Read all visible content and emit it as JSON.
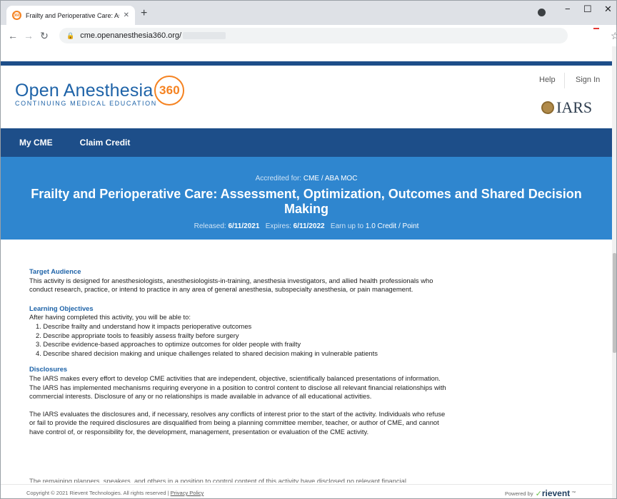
{
  "browser": {
    "tab_title": "Frailty and Perioperative Care: As",
    "tab_favicon": "360",
    "url": "cme.openanesthesia360.org/",
    "icons": [
      "back-icon",
      "forward-icon",
      "reload-icon",
      "lock-icon",
      "star-icon",
      "close-icon",
      "plus-icon"
    ]
  },
  "header": {
    "logo_text": "Open Anesthesia",
    "logo_badge": "360",
    "logo_subtitle": "CONTINUING MEDICAL EDUCATION",
    "help_label": "Help",
    "signin_label": "Sign In",
    "partner_logo": "IARS"
  },
  "nav": {
    "my_cme": "My CME",
    "claim_credit": "Claim Credit"
  },
  "hero": {
    "accredited_label": "Accredited for:",
    "accredited_value": "CME / ABA MOC",
    "title": "Frailty and Perioperative Care: Assessment, Optimization, Outcomes and Shared Decision Making",
    "released_label": "Released:",
    "released_value": "6/11/2021",
    "expires_label": "Expires:",
    "expires_value": "6/11/2022",
    "earn_label": "Earn up to",
    "earn_value": "1.0 Credit / Point",
    "bg_color": "#2f86cf"
  },
  "content": {
    "target_title": "Target Audience",
    "target_text": "This activity is designed for anesthesiologists, anesthesiologists-in-training, anesthesia investigators, and allied health professionals who conduct research, practice, or intend to practice in any area of general anesthesia, subspecialty anesthesia, or pain management.",
    "objectives_title": "Learning Objectives",
    "objectives_intro": "After having completed this activity, you will be able to:",
    "objectives": [
      "1. Describe frailty and understand how it impacts perioperative outcomes",
      "2. Describe appropriate tools to feasibly assess frailty before surgery",
      "3. Describe evidence-based approaches to optimize outcomes for older people with frailty",
      "4. Describe shared decision making and unique challenges related to shared decision making in vulnerable patients"
    ],
    "disclosures_title": "Disclosures",
    "disclosures_p1": "The IARS makes every effort to develop CME activities that are independent, objective, scientifically balanced presentations of information. The IARS has implemented mechanisms requiring everyone in a position to control content to disclose all relevant financial relationships with commercial interests. Disclosure of any or no relationships is made available in advance of all educational activities.",
    "disclosures_p2": "The IARS evaluates the disclosures and, if necessary, resolves any conflicts of interest prior to the start of the activity. Individuals who refuse or fail to provide the required disclosures are disqualified from being a planning committee member, teacher, or author of CME, and cannot have control of, or responsibility for, the development, management, presentation or evaluation of the CME activity.",
    "disclosures_p3_partial": "The remaining planners, speakers, and others in a position to control content of this activity have disclosed no relevant financial"
  },
  "footer": {
    "copyright": "Copyright © 2021 Rievent Technologies. All rights reserved |",
    "privacy": "Privacy Policy",
    "powered_by": "Powered by",
    "brand": "rievent",
    "tm": "™"
  }
}
